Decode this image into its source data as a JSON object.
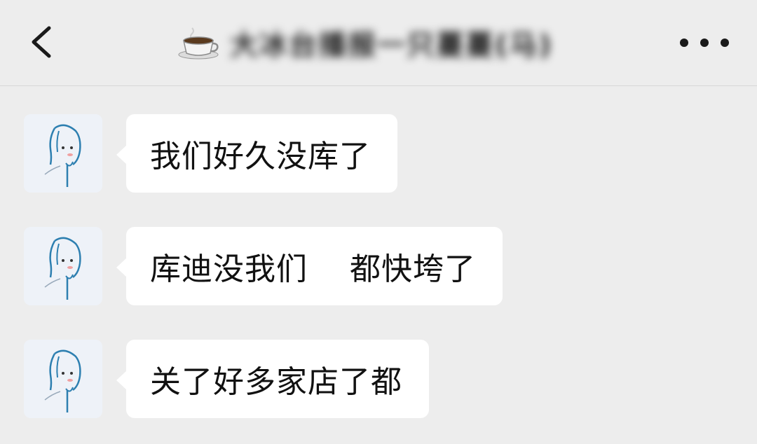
{
  "header": {
    "back_icon": "chevron-left-icon",
    "title_emoji_icon": "coffee-cup-icon",
    "title": "大冰台播报一只蔓蔓(马)",
    "more_icon": "more-dots-icon"
  },
  "messages": [
    {
      "sender": "other",
      "avatar_icon": "girl-sketch-avatar",
      "text": "我们好久没库了"
    },
    {
      "sender": "other",
      "avatar_icon": "girl-sketch-avatar",
      "text": "库迪没我们    都快垮了"
    },
    {
      "sender": "other",
      "avatar_icon": "girl-sketch-avatar",
      "text": "关了好多家店了都"
    }
  ],
  "colors": {
    "background": "#ededed",
    "bubble": "#ffffff",
    "text": "#111111"
  }
}
